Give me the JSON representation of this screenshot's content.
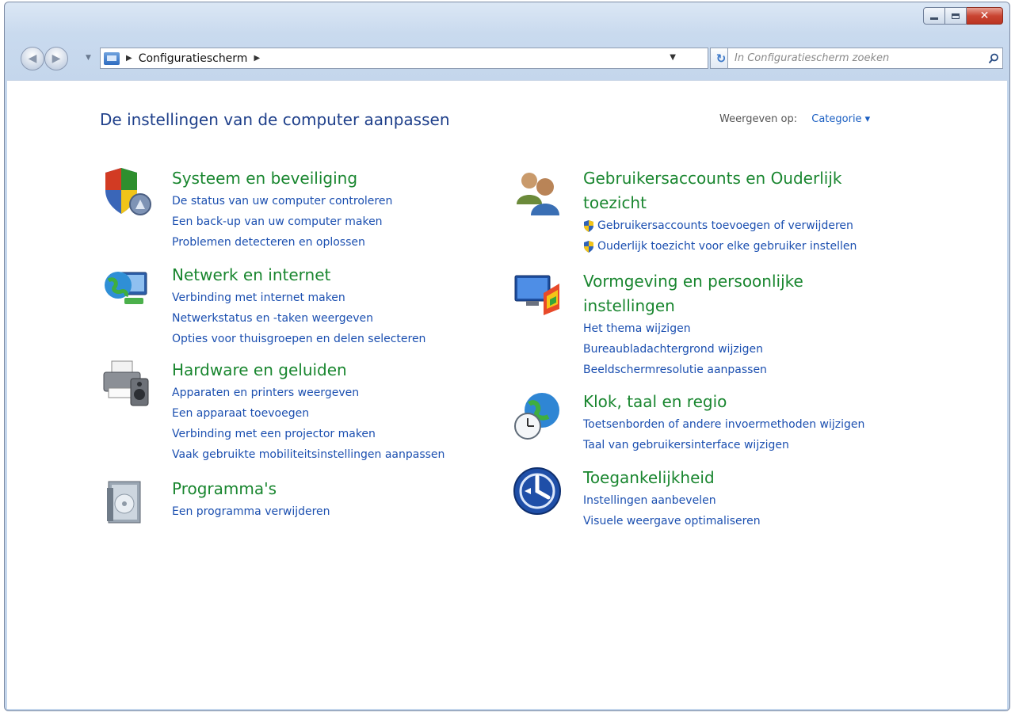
{
  "window": {
    "caption_buttons": {
      "minimize_icon": "minimize-icon",
      "maximize_icon": "maximize-icon",
      "close_icon": "close-icon"
    }
  },
  "navbar": {
    "breadcrumb": "Configuratiescherm",
    "search_placeholder": "In Configuratiescherm zoeken"
  },
  "header": {
    "title": "De instellingen van de computer aanpassen",
    "view_by_label": "Weergeven op:",
    "view_by_value": "Categorie ▾"
  },
  "categories_left": [
    {
      "icon": "security-shield-icon",
      "title": "Systeem en beveiliging",
      "links": [
        "De status van uw computer controleren",
        "Een back-up van uw computer maken",
        "Problemen detecteren en oplossen"
      ]
    },
    {
      "icon": "network-globe-icon",
      "title": "Netwerk en internet",
      "links": [
        "Verbinding met internet maken",
        "Netwerkstatus en -taken weergeven",
        "Opties voor thuisgroepen en delen selecteren"
      ]
    },
    {
      "icon": "printer-icon",
      "title": "Hardware en geluiden",
      "links": [
        "Apparaten en printers weergeven",
        "Een apparaat toevoegen",
        "Verbinding met een projector maken",
        "Vaak gebruikte mobiliteitsinstellingen aanpassen"
      ]
    },
    {
      "icon": "programs-box-icon",
      "title": "Programma's",
      "links": [
        "Een programma verwijderen"
      ]
    }
  ],
  "categories_right": [
    {
      "icon": "users-icon",
      "title_line1": "Gebruikersaccounts en Ouderlijk",
      "title_line2": "toezicht",
      "links": [
        "Gebruikersaccounts toevoegen of verwijderen",
        "Ouderlijk toezicht voor elke gebruiker instellen"
      ]
    },
    {
      "icon": "appearance-monitor-icon",
      "title_line1": "Vormgeving en persoonlijke",
      "title_line2": "instellingen",
      "links": [
        "Het thema wijzigen",
        "Bureaubladachtergrond wijzigen",
        "Beeldschermresolutie aanpassen"
      ]
    },
    {
      "icon": "clock-globe-icon",
      "title": "Klok, taal en regio",
      "links": [
        "Toetsenborden of andere invoermethoden wijzigen",
        "Taal van gebruikersinterface wijzigen"
      ]
    },
    {
      "icon": "accessibility-icon",
      "title": "Toegankelijkheid",
      "links": [
        "Instellingen aanbevelen",
        "Visuele weergave optimaliseren"
      ]
    }
  ]
}
